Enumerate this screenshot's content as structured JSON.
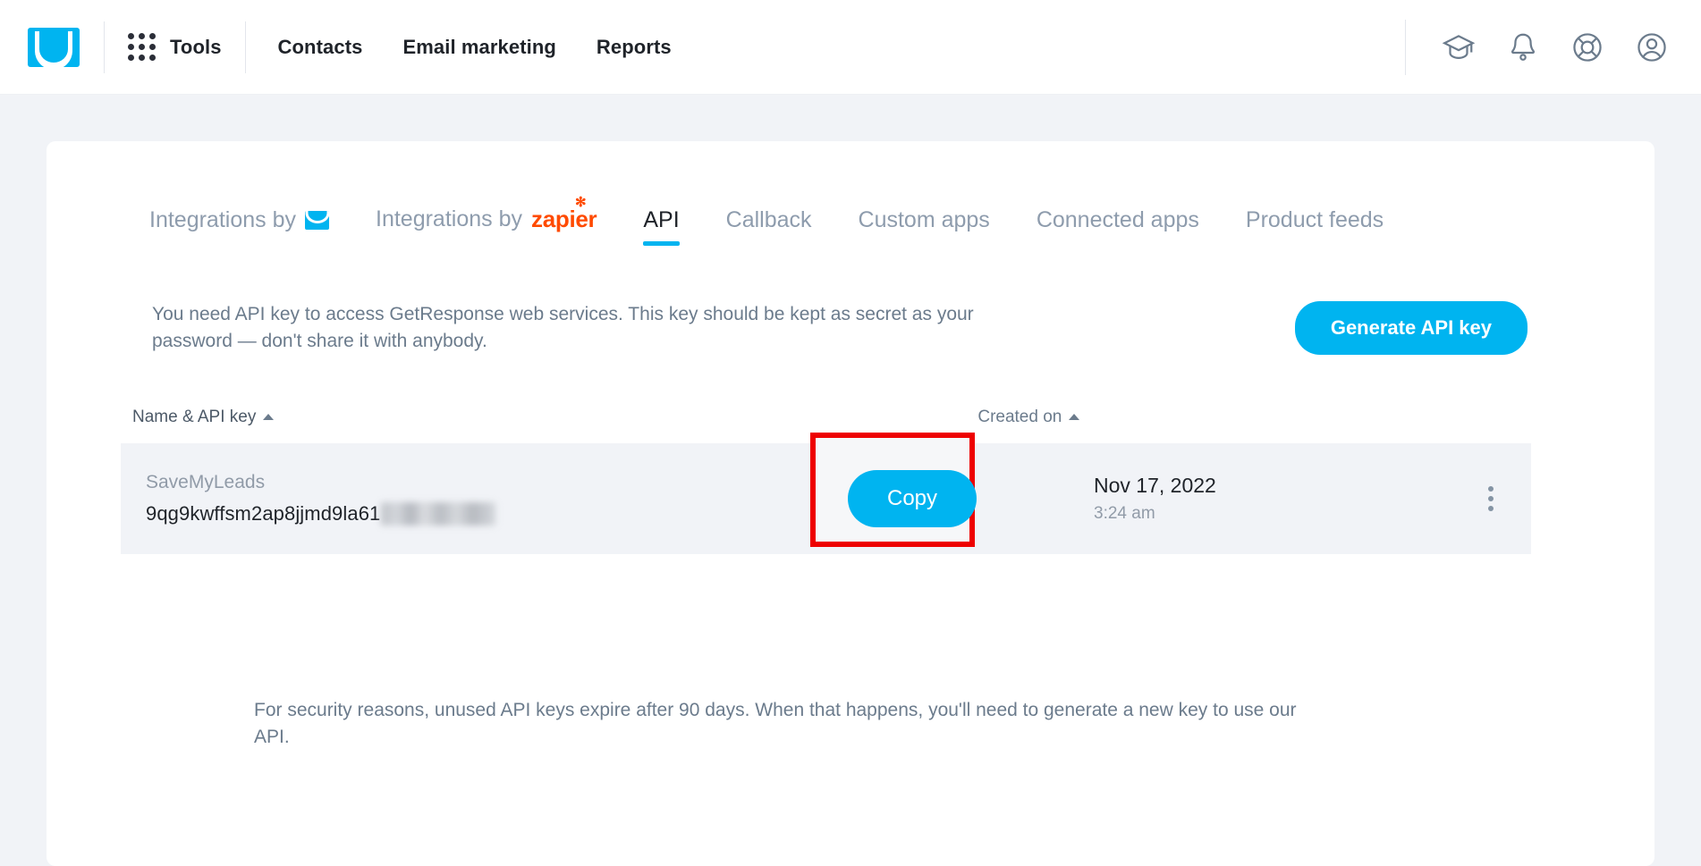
{
  "header": {
    "logo_icon": "getresponse-envelope-logo",
    "tools": {
      "label": "Tools",
      "icon": "grid-apps-icon"
    },
    "nav": [
      {
        "label": "Contacts"
      },
      {
        "label": "Email marketing"
      },
      {
        "label": "Reports"
      }
    ],
    "actions": [
      {
        "icon": "graduation-cap-icon"
      },
      {
        "icon": "bell-icon"
      },
      {
        "icon": "lifebuoy-help-icon"
      },
      {
        "icon": "user-account-icon"
      }
    ]
  },
  "tabs": [
    {
      "label": "Integrations by",
      "icon": "getresponse-envelope-icon",
      "active": false
    },
    {
      "label": "Integrations by",
      "icon": "zapier-logo",
      "brand": "zapier",
      "active": false
    },
    {
      "label": "API",
      "active": true
    },
    {
      "label": "Callback",
      "active": false
    },
    {
      "label": "Custom apps",
      "active": false
    },
    {
      "label": "Connected apps",
      "active": false
    },
    {
      "label": "Product feeds",
      "active": false
    }
  ],
  "intro": {
    "text": "You need API key to access GetResponse web services. This key should be kept as secret as your password — don't share it with anybody.",
    "generate_button": "Generate API key"
  },
  "table": {
    "columns": [
      {
        "label": "Name & API key",
        "sort": "asc",
        "sort_icon": "caret-up-icon"
      },
      {
        "label": "Created on",
        "sort": "asc",
        "sort_icon": "caret-up-icon"
      }
    ],
    "rows": [
      {
        "name": "SaveMyLeads",
        "api_key": "9qg9kwffsm2ap8jjmd9la61",
        "api_key_masked": true,
        "copy_button": "Copy",
        "created_date": "Nov 17, 2022",
        "created_time": "3:24 am",
        "menu_icon": "kebab-menu-icon"
      }
    ]
  },
  "footnote": "For security reasons, unused API keys expire after 90 days. When that happens, you'll need to generate a new key to use our API.",
  "colors": {
    "brand_blue": "#00b4f0",
    "zapier_orange": "#ff4a00",
    "highlight_red": "#ee0000",
    "page_bg": "#f1f3f7",
    "row_bg": "#f1f3f7",
    "muted_text": "#6b7b8c"
  }
}
